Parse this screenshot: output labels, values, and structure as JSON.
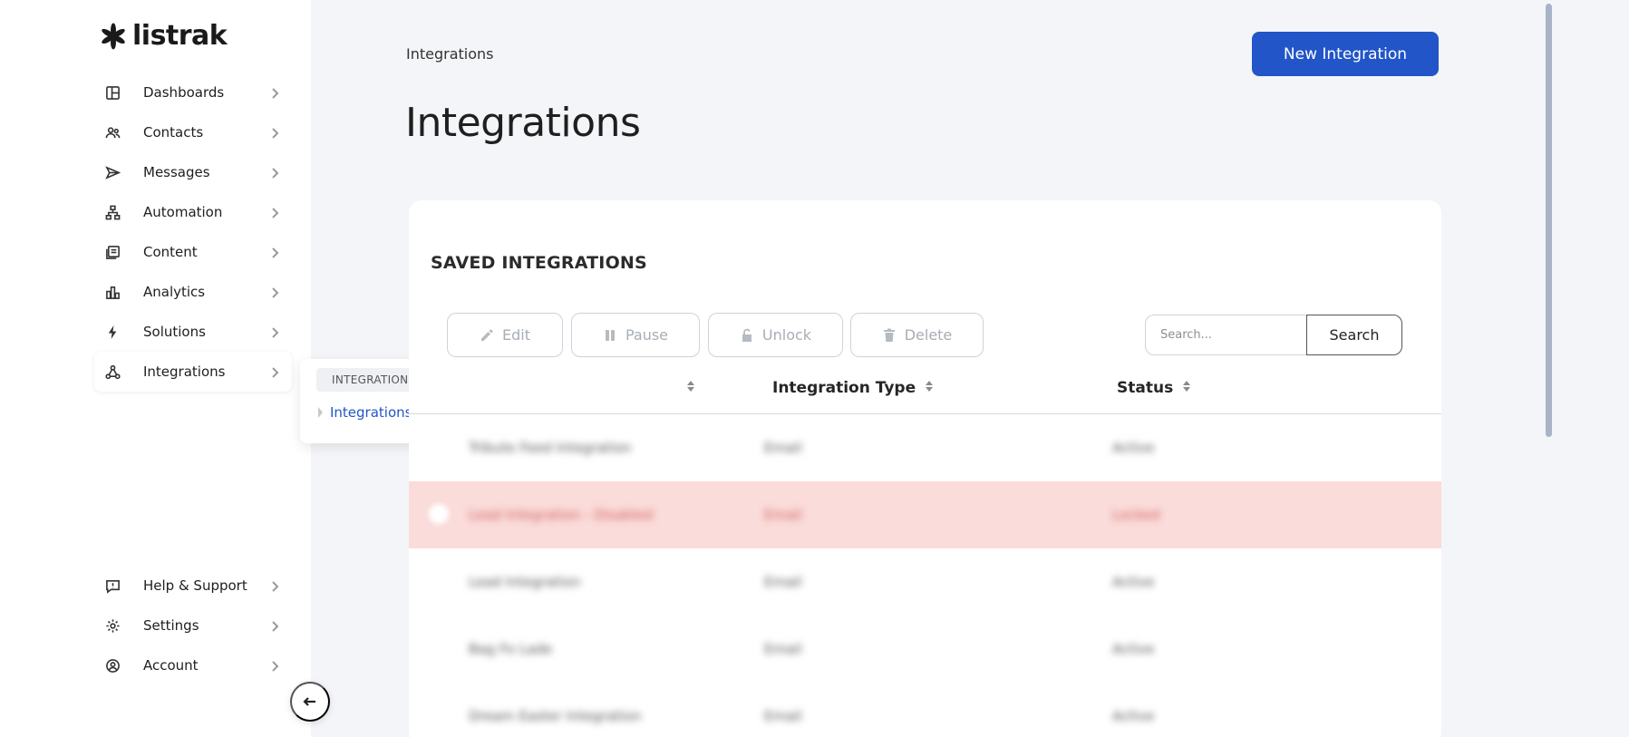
{
  "brand": {
    "name": "listrak"
  },
  "sidebar": {
    "items": [
      {
        "label": "Dashboards",
        "icon": "dashboard-icon"
      },
      {
        "label": "Contacts",
        "icon": "contacts-icon"
      },
      {
        "label": "Messages",
        "icon": "send-icon"
      },
      {
        "label": "Automation",
        "icon": "automation-icon"
      },
      {
        "label": "Content",
        "icon": "content-icon"
      },
      {
        "label": "Analytics",
        "icon": "bar-chart-icon"
      },
      {
        "label": "Solutions",
        "icon": "bolt-icon"
      },
      {
        "label": "Integrations",
        "icon": "integrations-icon",
        "active": true
      }
    ],
    "bottom_items": [
      {
        "label": "Help & Support",
        "icon": "help-icon"
      },
      {
        "label": "Settings",
        "icon": "gear-icon"
      },
      {
        "label": "Account",
        "icon": "account-icon"
      }
    ],
    "collapse_icon": "arrow-left-icon"
  },
  "flyout": {
    "header": "INTEGRATIONS",
    "link": "Integrations Management"
  },
  "header": {
    "breadcrumb": "Integrations",
    "title": "Integrations",
    "new_button": "New Integration"
  },
  "card": {
    "title": "SAVED INTEGRATIONS",
    "toolbar": {
      "edit": "Edit",
      "pause": "Pause",
      "unlock": "Unlock",
      "delete": "Delete"
    },
    "search": {
      "placeholder": "Search...",
      "button": "Search"
    },
    "columns": [
      "Integration Type",
      "Status"
    ],
    "rows": [
      {
        "name": "Tribute Feed Integration",
        "type": "Email",
        "status": "Active",
        "alert": false
      },
      {
        "name": "Lead Integration - Disabled",
        "type": "Email",
        "status": "Locked",
        "alert": true
      },
      {
        "name": "Lead Integration",
        "type": "Email",
        "status": "Active",
        "alert": false
      },
      {
        "name": "Bag Fo Lade",
        "type": "Email",
        "status": "Active",
        "alert": false
      },
      {
        "name": "Dream Easter Integration",
        "type": "Email",
        "status": "Active",
        "alert": false
      }
    ]
  },
  "colors": {
    "primary": "#2155c8",
    "link": "#2355c6",
    "alert_row": "#fadcda",
    "background": "#f4f5f8"
  }
}
